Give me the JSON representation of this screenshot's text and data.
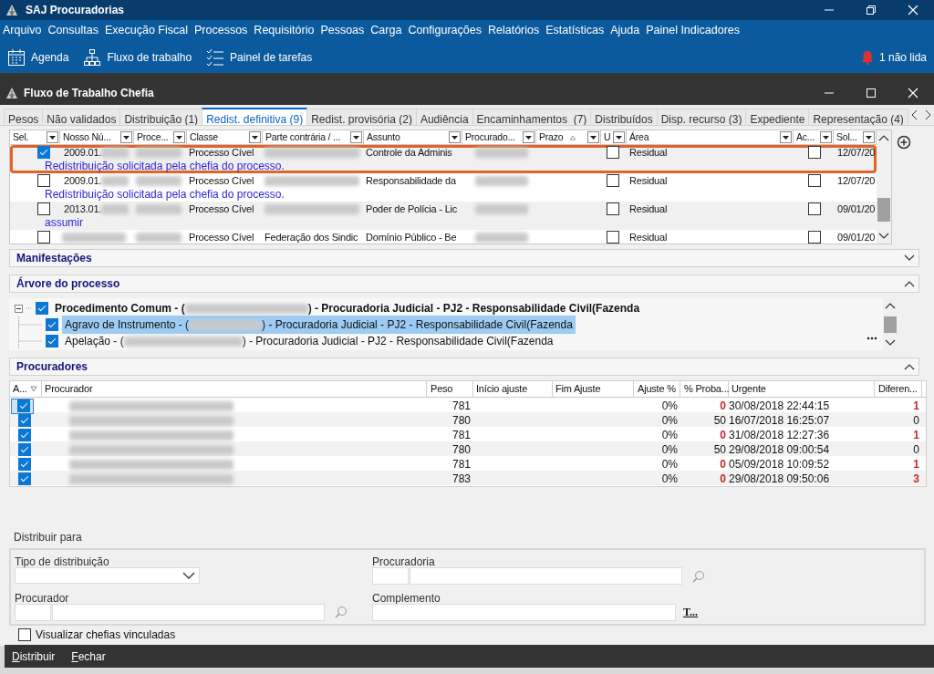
{
  "app": {
    "title": "SAJ Procuradorias"
  },
  "menu": [
    "Arquivo",
    "Consultas",
    "Execução Fiscal",
    "Processos",
    "Requisitório",
    "Pessoas",
    "Carga",
    "Configurações",
    "Relatórios",
    "Estatísticas",
    "Ajuda",
    "Painel Indicadores"
  ],
  "toolbar": [
    {
      "label": "Agenda",
      "kind": "calendar"
    },
    {
      "label": "Fluxo de trabalho",
      "kind": "hierarchy"
    },
    {
      "label": "Painel de tarefas",
      "kind": "checklist"
    }
  ],
  "notification": "1 não lida",
  "window": {
    "title": "Fluxo de Trabalho Chefia"
  },
  "tabs": [
    {
      "label": "Pesos",
      "selected": false
    },
    {
      "label": "Não validados",
      "selected": false
    },
    {
      "label": "Distribuição (1)",
      "selected": false
    },
    {
      "label": "Redist. definitiva (9)",
      "selected": true
    },
    {
      "label": "Redist. provisória (2)",
      "selected": false
    },
    {
      "label": "Audiência",
      "selected": false
    },
    {
      "label": "Encaminhamentos  (7)",
      "selected": false
    },
    {
      "label": "Distribuídos",
      "selected": false
    },
    {
      "label": "Disp. recurso (3)",
      "selected": false
    },
    {
      "label": "Expediente",
      "selected": false
    },
    {
      "label": "Representação (4)",
      "selected": false
    }
  ],
  "grid": {
    "columns": [
      "Sel.",
      "Nosso Nú...",
      "Proce...",
      "Classe",
      "Parte contrária / ...",
      "Assunto",
      "Procurado...",
      "Prazo",
      "U",
      "Área",
      "Ac...",
      "Sol..."
    ],
    "rows": [
      {
        "selected": true,
        "highlighted": true,
        "nosso_numero": "2009.01.",
        "classe": "Processo Cível",
        "assunto": "Controle da Adminis",
        "u": false,
        "area": "Residual",
        "ac": false,
        "sol": "12/07/20",
        "note": "Redistribuição solicitada pela chefia do processo."
      },
      {
        "selected": false,
        "highlighted": false,
        "nosso_numero": "2009.01.",
        "classe": "Processo Cível",
        "assunto": "Responsabilidade da",
        "u": false,
        "area": "Residual",
        "ac": false,
        "sol": "12/07/20",
        "note": "Redistribuição solicitada pela chefia do processo."
      },
      {
        "selected": false,
        "highlighted": false,
        "nosso_numero": "2013.01.",
        "classe": "Processo Cível",
        "assunto": "Poder de Polícia - Lic",
        "u": false,
        "area": "Residual",
        "ac": false,
        "sol": "09/01/20",
        "note": "assumir"
      },
      {
        "selected": false,
        "highlighted": false,
        "classe": "Processo Cível",
        "parte": "Federação dos Sindic",
        "assunto": "Domínio Público - Be",
        "u": false,
        "area": "Residual",
        "ac": false,
        "sol": "09/01/20"
      }
    ]
  },
  "sections": [
    {
      "title": "Manifestações",
      "expanded": false
    },
    {
      "title": "Árvore do processo",
      "expanded": true
    },
    {
      "title": "Procuradores",
      "expanded": true
    }
  ],
  "tree": [
    {
      "before": "Procedimento Comum - (",
      "after": ") - Procuradoria Judicial - PJ2 - Responsabilidade Civil(Fazenda",
      "checked": true,
      "expanded": true,
      "selected": false,
      "children": [
        {
          "before": "Agravo de Instrumento - (",
          "after": ") - Procuradoria Judicial - PJ2 - Responsabilidade Civil(Fazenda",
          "checked": true,
          "selected": true
        },
        {
          "before": "Apelação - (",
          "after": ") - Procuradoria Judicial - PJ2 - Responsabilidade Civil(Fazenda",
          "checked": true,
          "selected": false
        }
      ]
    }
  ],
  "procuradores": {
    "columns": [
      "A...",
      "Procurador",
      "Peso",
      "Início ajuste",
      "Fim Ajuste",
      "Ajuste %",
      "% Proba...",
      "Urgente",
      "Diferen..."
    ],
    "rows": [
      {
        "checked": true,
        "selected": true,
        "peso": "781",
        "ajuste": "0%",
        "proba": "0",
        "proba_alert": true,
        "urgente": "30/08/2018 22:44:15",
        "diferenca": "1",
        "diferenca_alert": true
      },
      {
        "checked": true,
        "selected": false,
        "peso": "780",
        "ajuste": "0%",
        "proba": "50",
        "proba_alert": false,
        "urgente": "16/07/2018 16:25:07",
        "diferenca": "0",
        "diferenca_alert": false
      },
      {
        "checked": true,
        "selected": false,
        "peso": "781",
        "ajuste": "0%",
        "proba": "0",
        "proba_alert": true,
        "urgente": "31/08/2018 12:27:36",
        "diferenca": "1",
        "diferenca_alert": true
      },
      {
        "checked": true,
        "selected": false,
        "peso": "780",
        "ajuste": "0%",
        "proba": "50",
        "proba_alert": false,
        "urgente": "29/08/2018 09:00:54",
        "diferenca": "0",
        "diferenca_alert": false
      },
      {
        "checked": true,
        "selected": false,
        "peso": "781",
        "ajuste": "0%",
        "proba": "0",
        "proba_alert": true,
        "urgente": "05/09/2018 10:09:52",
        "diferenca": "1",
        "diferenca_alert": true
      },
      {
        "checked": true,
        "selected": false,
        "peso": "783",
        "ajuste": "0%",
        "proba": "0",
        "proba_alert": true,
        "urgente": "29/08/2018 09:50:06",
        "diferenca": "3",
        "diferenca_alert": true
      }
    ]
  },
  "form": {
    "title": "Distribuir para",
    "tipo_label": "Tipo de distribuição",
    "procuradoria_label": "Procuradoria",
    "procurador_label": "Procurador",
    "complemento_label": "Complemento",
    "complemento_button": "T..."
  },
  "vincular": {
    "label": "Visualizar chefias vinculadas",
    "checked": false
  },
  "actions": [
    "Distribuir",
    "Fechar"
  ]
}
